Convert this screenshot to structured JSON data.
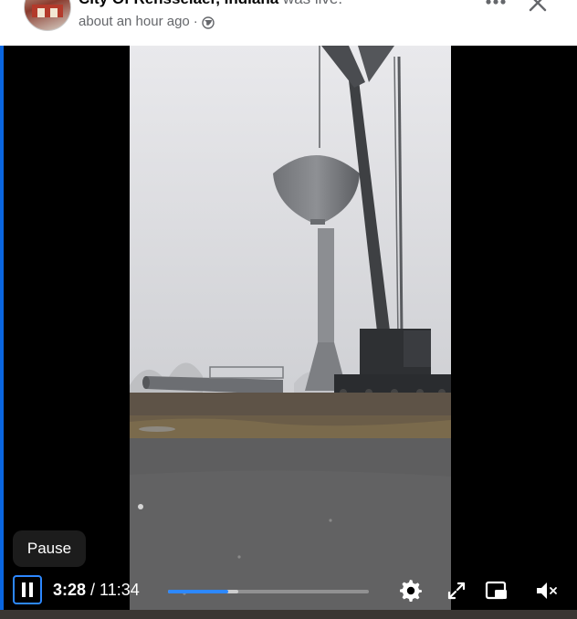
{
  "post": {
    "author": "City Of Rensselaer, Indiana",
    "status": " was live.",
    "time": "about an hour ago",
    "separator": "·",
    "audience_icon": "globe-icon"
  },
  "header_actions": {
    "more_icon": "more-horizontal-icon",
    "close_icon": "close-icon"
  },
  "video": {
    "tooltip": "Pause",
    "current_time": "3:28",
    "time_separator": " / ",
    "duration": "11:34",
    "played_fraction": 0.3,
    "buffered_fraction": 0.35,
    "icons": [
      "pause-icon",
      "gear-icon",
      "fullscreen-icon",
      "picture-in-picture-icon",
      "volume-muted-icon"
    ]
  },
  "colors": {
    "accent": "#2d88ff",
    "video_bg": "#000000",
    "secondary_text": "#65676b"
  }
}
